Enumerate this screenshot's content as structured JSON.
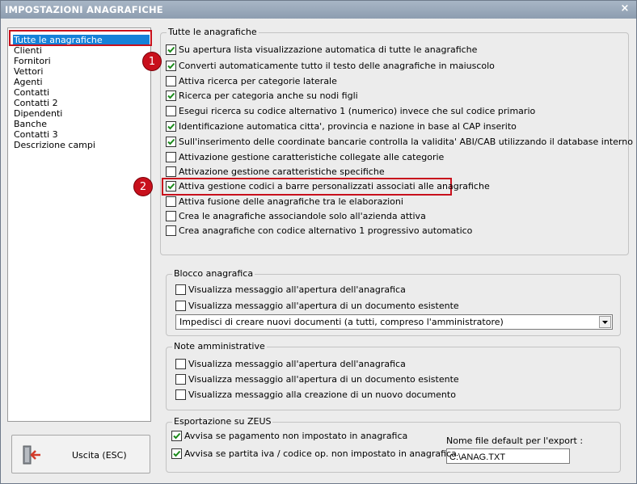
{
  "window": {
    "title": "IMPOSTAZIONI ANAGRAFICHE",
    "close_glyph": "×"
  },
  "sidebar": {
    "items": [
      "Tutte le anagrafiche",
      "Clienti",
      "Fornitori",
      "Vettori",
      "Agenti",
      "Contatti",
      "Contatti 2",
      "Dipendenti",
      "Banche",
      "Contatti 3",
      "Descrizione campi"
    ],
    "selected_index": 0
  },
  "exit_button": {
    "label": "Uscita (ESC)",
    "icon": "exit-door-icon"
  },
  "badges": [
    "1",
    "2"
  ],
  "group_all": {
    "legend": "Tutte le anagrafiche",
    "options": [
      {
        "label": "Su apertura lista visualizzazione automatica di tutte le anagrafiche",
        "checked": true
      },
      {
        "label": "Converti automaticamente tutto il testo delle anagrafiche in maiuscolo",
        "checked": true
      },
      {
        "label": "Attiva ricerca per categorie laterale",
        "checked": false
      },
      {
        "label": "Ricerca per categoria anche su nodi figli",
        "checked": true
      },
      {
        "label": "Esegui ricerca su codice alternativo 1 (numerico) invece che sul codice primario",
        "checked": false
      },
      {
        "label": "Identificazione automatica citta', provincia e nazione in base al CAP inserito",
        "checked": true
      },
      {
        "label": "Sull'inserimento delle coordinate bancarie controlla la validita' ABI/CAB utilizzando il database interno",
        "checked": true
      },
      {
        "label": "Attivazione gestione caratteristiche collegate alle categorie",
        "checked": false
      },
      {
        "label": "Attivazione gestione caratteristiche specifiche",
        "checked": false
      },
      {
        "label": "Attiva gestione codici a barre personalizzati associati alle anagrafiche",
        "checked": true
      },
      {
        "label": "Attiva fusione delle anagrafiche tra le elaborazioni",
        "checked": false
      },
      {
        "label": "Crea le anagrafiche associandole solo all'azienda attiva",
        "checked": false
      },
      {
        "label": "Crea anagrafiche con codice alternativo 1 progressivo automatico",
        "checked": false
      }
    ]
  },
  "group_block": {
    "legend": "Blocco anagrafica",
    "options": [
      {
        "label": "Visualizza messaggio all'apertura dell'anagrafica",
        "checked": false
      },
      {
        "label": "Visualizza messaggio all'apertura di un documento esistente",
        "checked": false
      }
    ],
    "select_value": "Impedisci di creare nuovi documenti (a tutti, compreso l'amministratore)"
  },
  "group_notes": {
    "legend": "Note amministrative",
    "options": [
      {
        "label": "Visualizza messaggio all'apertura dell'anagrafica",
        "checked": false
      },
      {
        "label": "Visualizza messaggio all'apertura di un documento esistente",
        "checked": false
      },
      {
        "label": "Visualizza messaggio alla creazione di un nuovo documento",
        "checked": false
      }
    ]
  },
  "group_export": {
    "legend": "Esportazione su ZEUS",
    "options": [
      {
        "label": "Avvisa se pagamento non impostato in anagrafica",
        "checked": true
      },
      {
        "label": "Avvisa se partita iva / codice op. non impostato in anagrafica",
        "checked": true
      }
    ],
    "filename_label": "Nome file default per l'export :",
    "filename_value": "C:\\ANAG.TXT"
  },
  "colors": {
    "accent_red": "#c8101c",
    "selection_blue": "#1681d8",
    "titlebar": "#97a6b8"
  }
}
